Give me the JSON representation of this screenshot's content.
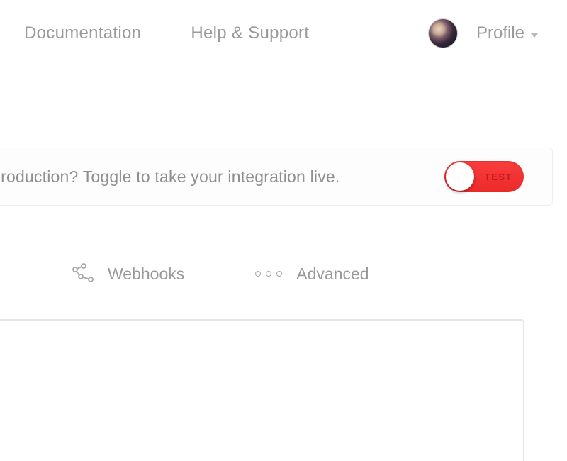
{
  "nav": {
    "documentation": "Documentation",
    "help": "Help & Support",
    "profile": "Profile"
  },
  "banner": {
    "text": "Ready for production? Toggle to take your integration live.",
    "toggle_label": "TEST",
    "toggle_state": "test",
    "colors": {
      "toggle_bg": "#f03b3b"
    }
  },
  "tabs": {
    "webhooks": "Webhooks",
    "advanced": "Advanced"
  }
}
